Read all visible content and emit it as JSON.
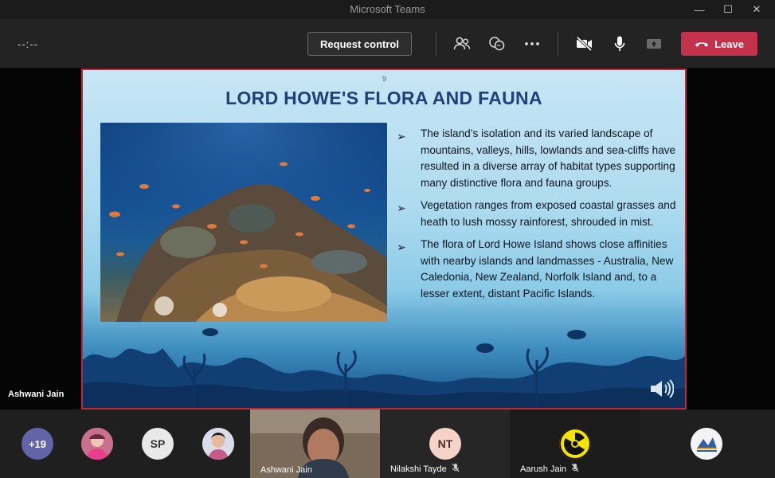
{
  "window": {
    "title": "Microsoft Teams"
  },
  "toolbar": {
    "timer": "--:--",
    "request_control_label": "Request control",
    "leave_label": "Leave"
  },
  "presenter": {
    "name": "Ashwani Jain"
  },
  "slide": {
    "number": "9",
    "title": "LORD HOWE'S FLORA AND FAUNA",
    "bullets": [
      "The island’s isolation and its varied landscape of mountains, valleys, hills, lowlands and sea-cliffs have resulted in a diverse array of habitat types supporting many distinctive flora and fauna groups.",
      "Vegetation ranges from exposed coastal grasses and heath to lush mossy rainforest, shrouded in mist.",
      "The flora of Lord Howe Island shows close affinities with nearby islands and landmasses - Australia, New Caledonia, New Zealand, Norfolk Island and, to a lesser extent, distant Pacific Islands."
    ]
  },
  "participants": {
    "overflow_count": "+19",
    "initials_sp": "SP",
    "initials_nt": "NT",
    "tiles": {
      "ashwani": "Ashwani Jain",
      "nilakshi": "Nilakshi Tayde",
      "aarush": "Aarush Jain"
    }
  },
  "colors": {
    "leave": "#c4314b",
    "slide_border": "#c0283a",
    "title_text": "#213f78"
  },
  "icons": [
    "people-icon",
    "chat-icon",
    "more-icon",
    "camera-off-icon",
    "mic-icon",
    "share-tray-icon",
    "phone-hangup-icon",
    "speaker-icon",
    "mic-off-icon"
  ]
}
